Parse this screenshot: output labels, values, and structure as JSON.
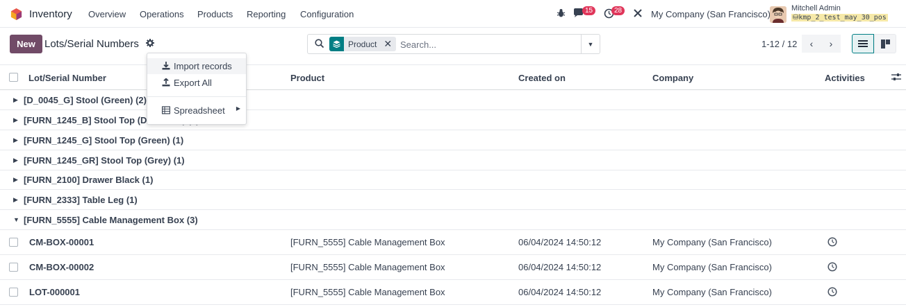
{
  "navbar": {
    "app_name": "Inventory",
    "menu": [
      "Overview",
      "Operations",
      "Products",
      "Reporting",
      "Configuration"
    ],
    "messages_count": "15",
    "activities_count": "28",
    "company": "My Company (San Francisco)",
    "user_name": "Mitchell Admin",
    "database": "kmp_2_test_may_30_pos"
  },
  "control": {
    "new_label": "New",
    "title": "Lots/Serial Numbers",
    "facet_label": "Product",
    "search_placeholder": "Search...",
    "pager": "1-12 / 12"
  },
  "table": {
    "headers": {
      "lot": "Lot/Serial Number",
      "product": "Product",
      "created": "Created on",
      "company": "Company",
      "activities": "Activities"
    },
    "groups": [
      {
        "label": "[D_0045_G] Stool (Green) (2)",
        "expanded": false
      },
      {
        "label": "[FURN_1245_B] Stool Top (Dark Blue) (1)",
        "expanded": false
      },
      {
        "label": "[FURN_1245_G] Stool Top (Green) (1)",
        "expanded": false
      },
      {
        "label": "[FURN_1245_GR] Stool Top (Grey) (1)",
        "expanded": false
      },
      {
        "label": "[FURN_2100] Drawer Black (1)",
        "expanded": false
      },
      {
        "label": "[FURN_2333] Table Leg (1)",
        "expanded": false
      },
      {
        "label": "[FURN_5555] Cable Management Box (3)",
        "expanded": true
      }
    ],
    "rows": [
      {
        "lot": "CM-BOX-00001",
        "product": "[FURN_5555] Cable Management Box",
        "created": "06/04/2024 14:50:12",
        "company": "My Company (San Francisco)"
      },
      {
        "lot": "CM-BOX-00002",
        "product": "[FURN_5555] Cable Management Box",
        "created": "06/04/2024 14:50:12",
        "company": "My Company (San Francisco)"
      },
      {
        "lot": "LOT-000001",
        "product": "[FURN_5555] Cable Management Box",
        "created": "06/04/2024 14:50:12",
        "company": "My Company (San Francisco)"
      }
    ]
  },
  "dropdown": {
    "import": "Import records",
    "export": "Export All",
    "spreadsheet": "Spreadsheet"
  },
  "colors": {
    "brand": "#714b67",
    "accent": "#017e84",
    "badge": "#e0365a"
  }
}
